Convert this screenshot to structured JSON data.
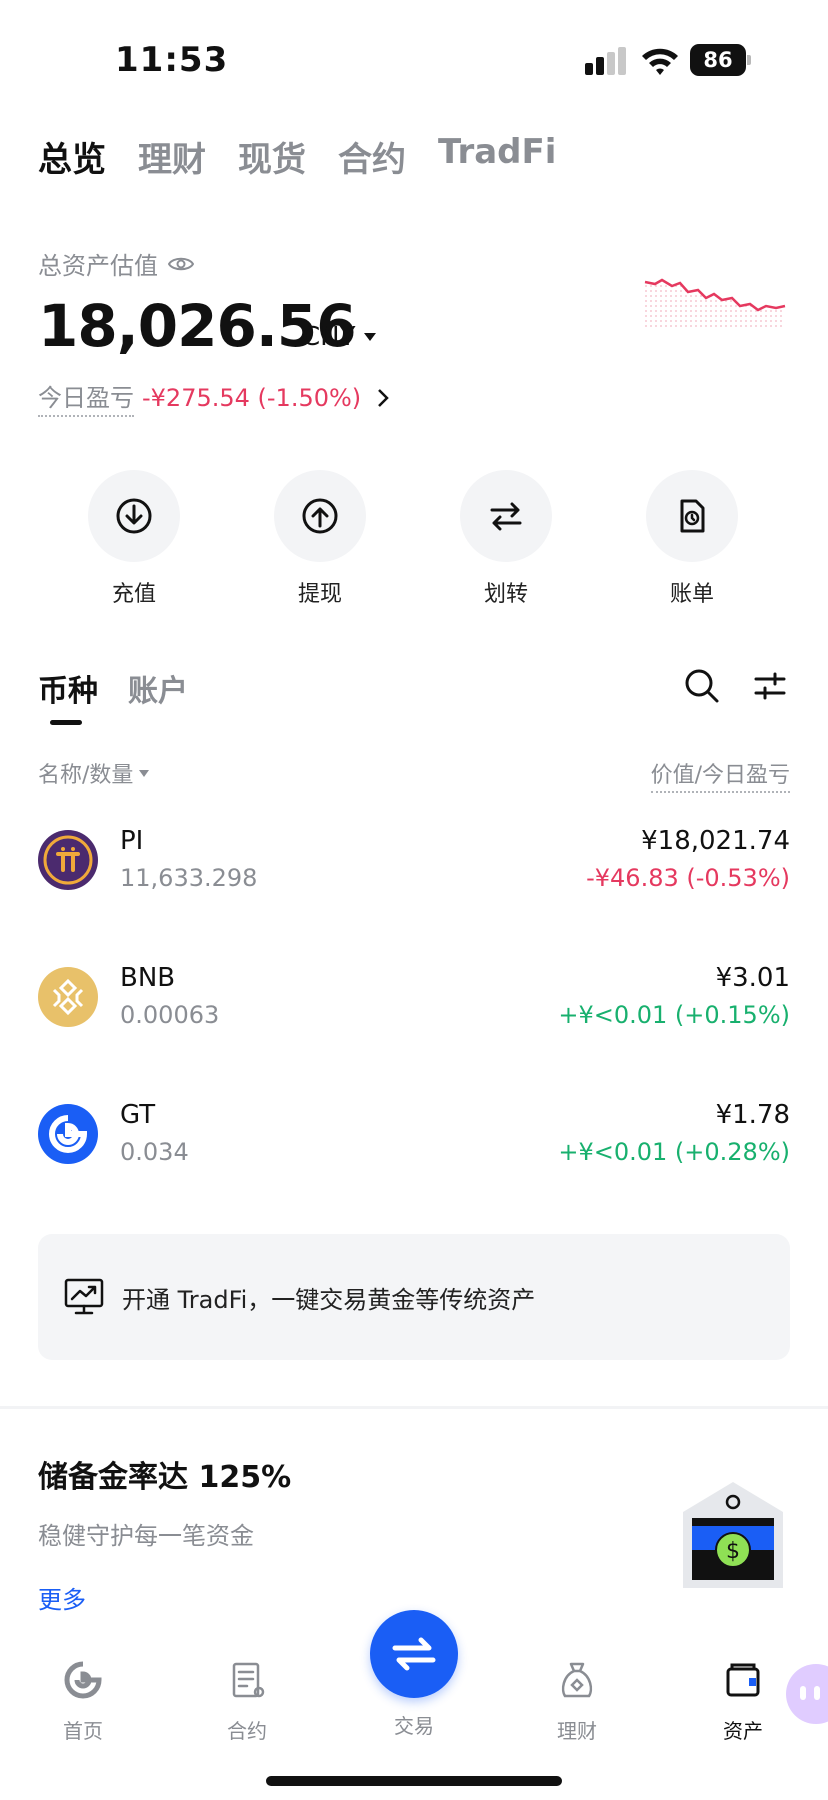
{
  "status_bar": {
    "time": "11:53",
    "battery": "86"
  },
  "top_tabs": [
    {
      "label": "总览",
      "active": true
    },
    {
      "label": "理财",
      "active": false
    },
    {
      "label": "现货",
      "active": false
    },
    {
      "label": "合约",
      "active": false
    },
    {
      "label": "TradFi",
      "active": false
    }
  ],
  "overview": {
    "asset_label": "总资产估值",
    "total_value": "18,026.56",
    "currency": "CNY",
    "pnl_label": "今日盈亏",
    "pnl_value": "-¥275.54 (-1.50%)"
  },
  "actions": [
    {
      "label": "充值",
      "icon": "deposit-icon"
    },
    {
      "label": "提现",
      "icon": "withdraw-icon"
    },
    {
      "label": "划转",
      "icon": "transfer-icon"
    },
    {
      "label": "账单",
      "icon": "bill-icon"
    }
  ],
  "coin_tabs": [
    {
      "label": "币种",
      "active": true
    },
    {
      "label": "账户",
      "active": false
    }
  ],
  "list_header": {
    "left": "名称/数量",
    "right": "价值/今日盈亏"
  },
  "coins": [
    {
      "symbol": "PI",
      "amount": "11,633.298",
      "value": "¥18,021.74",
      "change": "-¥46.83 (-0.53%)",
      "direction": "down"
    },
    {
      "symbol": "BNB",
      "amount": "0.00063",
      "value": "¥3.01",
      "change": "+¥<0.01 (+0.15%)",
      "direction": "up"
    },
    {
      "symbol": "GT",
      "amount": "0.034",
      "value": "¥1.78",
      "change": "+¥<0.01 (+0.28%)",
      "direction": "up"
    }
  ],
  "banner": {
    "text": "开通 TradFi，一键交易黄金等传统资产"
  },
  "reserve": {
    "title": "储备金率达 125%",
    "subtitle": "稳健守护每一笔资金",
    "more": "更多"
  },
  "bottom_nav": [
    {
      "label": "首页",
      "icon": "home-icon",
      "active": false
    },
    {
      "label": "合约",
      "icon": "futures-icon",
      "active": false
    },
    {
      "label": "交易",
      "icon": "trade-icon",
      "active": false
    },
    {
      "label": "理财",
      "icon": "earn-icon",
      "active": false
    },
    {
      "label": "资产",
      "icon": "assets-icon",
      "active": true
    }
  ],
  "colors": {
    "negative": "#e5395f",
    "positive": "#18b06e",
    "accent": "#1a5ef5"
  }
}
